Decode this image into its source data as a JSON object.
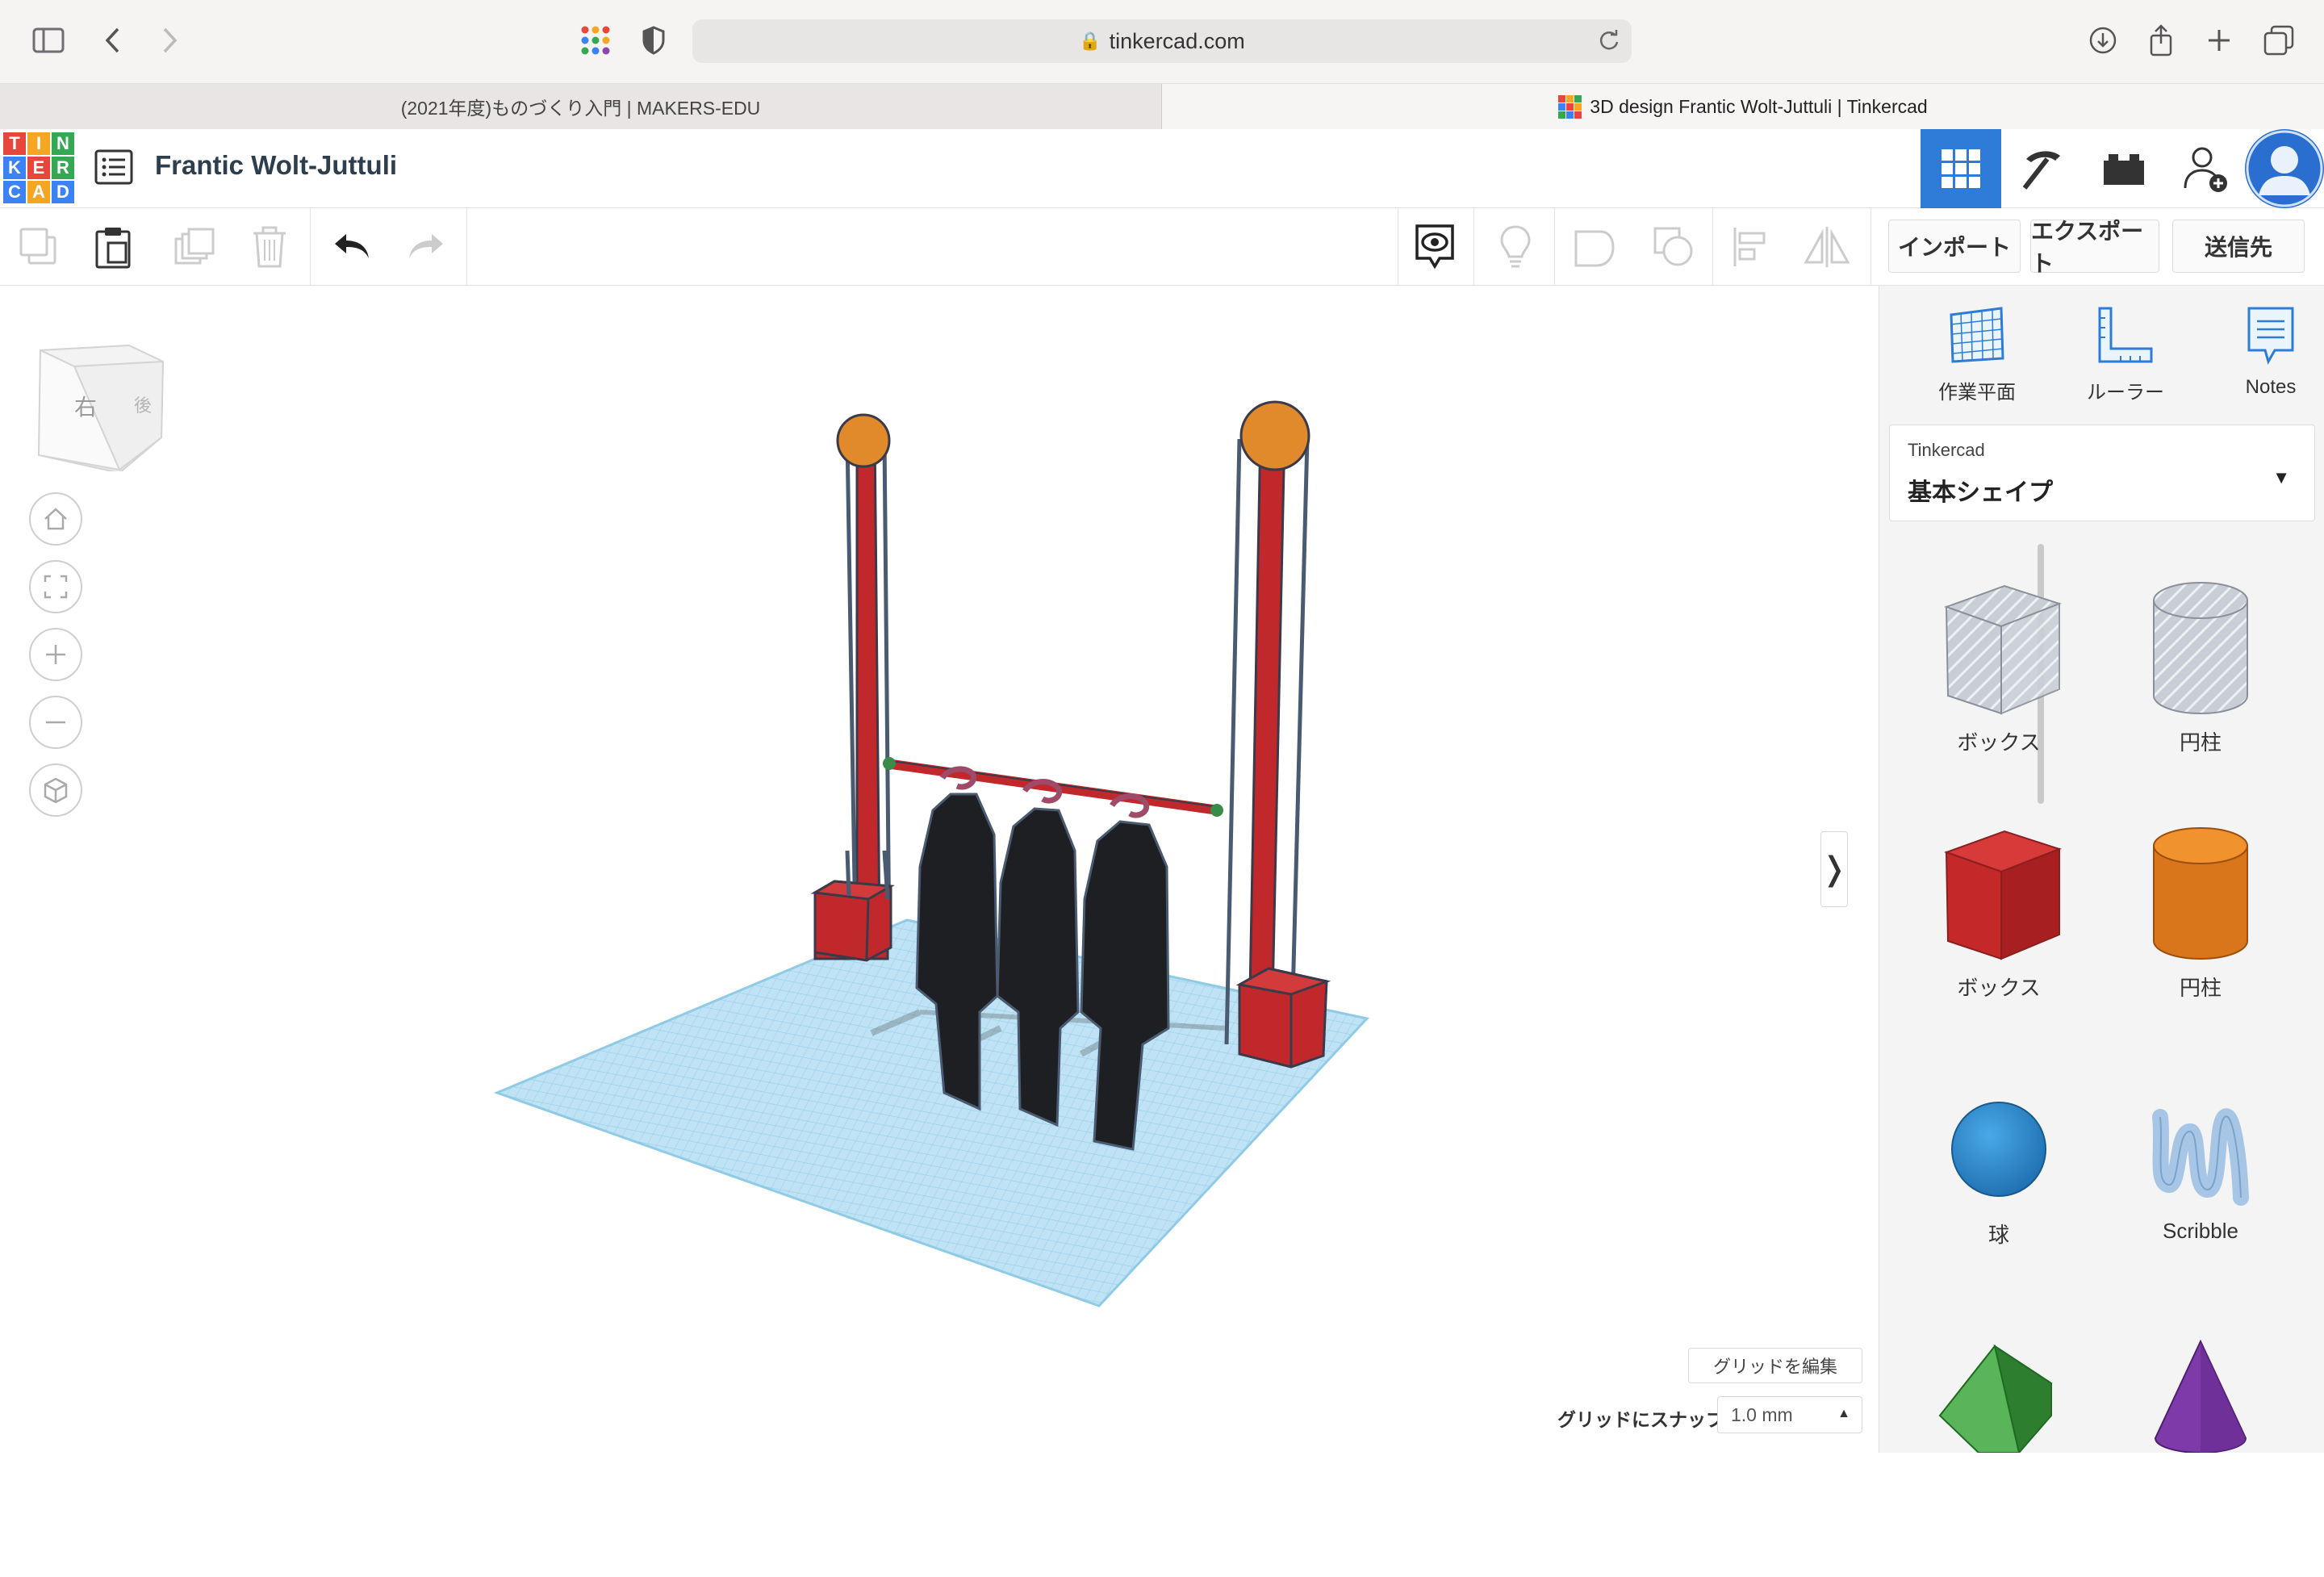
{
  "browser": {
    "url": "tinkercad.com",
    "tabs": [
      {
        "label": "(2021年度)ものづくり入門 | MAKERS-EDU"
      },
      {
        "label": "3D design Frantic Wolt-Juttuli | Tinkercad"
      }
    ]
  },
  "header": {
    "logo_letters": [
      "T",
      "I",
      "N",
      "K",
      "E",
      "R",
      "C",
      "A",
      "D"
    ],
    "design_title": "Frantic Wolt-Juttuli"
  },
  "toolbar": {
    "import_label": "インポート",
    "export_label": "エクスポート",
    "send_label": "送信先"
  },
  "viewcube": {
    "face_right": "右",
    "face_back": "後"
  },
  "panel": {
    "tools": [
      {
        "label": "作業平面",
        "icon": "workplane-icon"
      },
      {
        "label": "ルーラー",
        "icon": "ruler-icon"
      },
      {
        "label": "Notes",
        "icon": "notes-icon"
      }
    ],
    "library_source": "Tinkercad",
    "library_category": "基本シェイプ",
    "shapes": [
      {
        "label": "ボックス",
        "icon": "box-hole-icon"
      },
      {
        "label": "円柱",
        "icon": "cylinder-hole-icon"
      },
      {
        "label": "ボックス",
        "icon": "box-icon"
      },
      {
        "label": "円柱",
        "icon": "cylinder-icon"
      },
      {
        "label": "球",
        "icon": "sphere-icon"
      },
      {
        "label": "Scribble",
        "icon": "scribble-icon"
      },
      {
        "label": "",
        "icon": "roof-icon"
      },
      {
        "label": "",
        "icon": "cone-icon"
      }
    ]
  },
  "grid": {
    "edit_label": "グリッドを編集",
    "snap_label": "グリッドにスナップ",
    "snap_value": "1.0 mm"
  },
  "colors": {
    "accent": "#2f7bd8",
    "grid": "#a9d8ee",
    "post": "#c0282b",
    "cap": "#e08a2c",
    "garment": "#1e1f22"
  }
}
